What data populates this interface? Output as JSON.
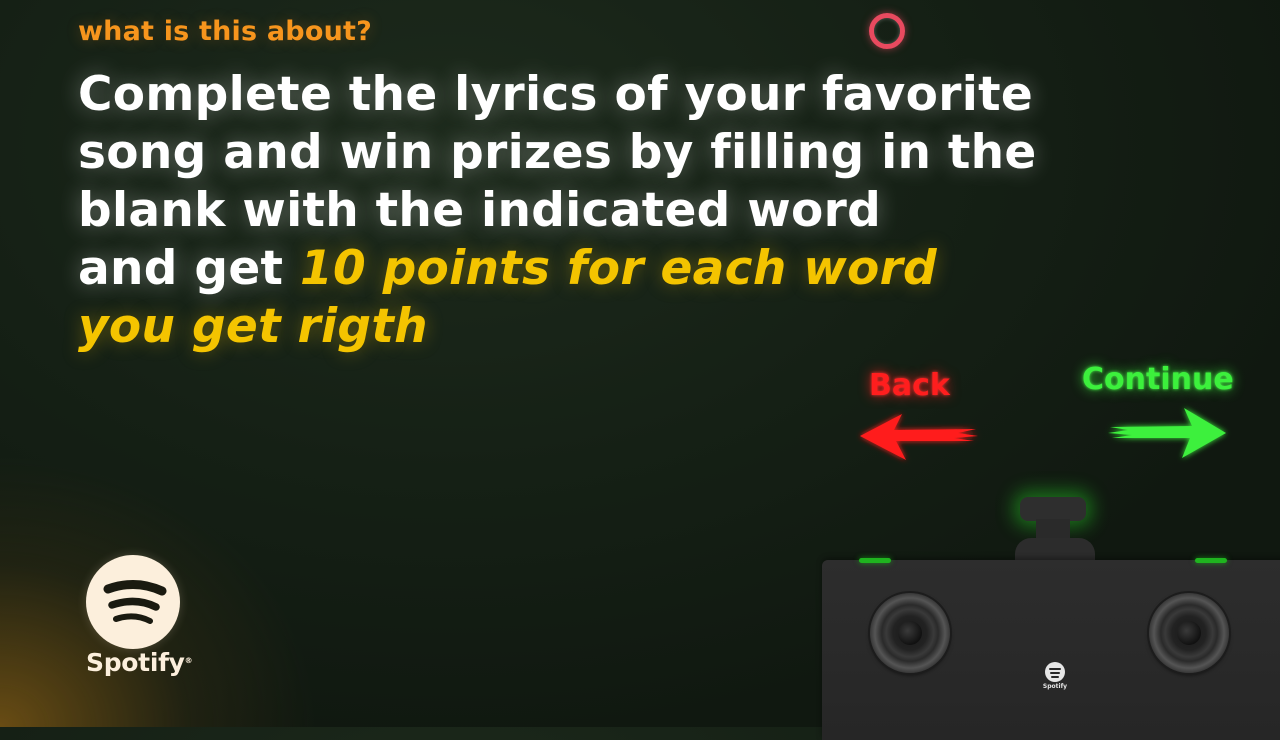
{
  "header": {
    "kicker": "what is this about?"
  },
  "headline": {
    "line1": "Complete the lyrics of  your favorite",
    "line2": "song and win prizes by filling in the",
    "line3": "blank with the indicated word",
    "line4_prefix": "and get ",
    "line4_highlight": "10 points for each word",
    "line5_highlight": "you get rigth"
  },
  "navigation": {
    "back_label": "Back",
    "continue_label": "Continue"
  },
  "brand": {
    "logo_text": "Spotify",
    "trademark": "®",
    "device_logo_text": "Spotify"
  },
  "colors": {
    "kicker": "#f7951d",
    "highlight": "#f4c400",
    "back": "#ff1e1e",
    "continue": "#3cf03c",
    "loader": "#e84a5f",
    "brand_cream": "#fcefdc"
  },
  "icons": {
    "loader": "loading-ring-icon",
    "back": "arrow-left-icon",
    "continue": "arrow-right-icon",
    "logo": "spotify-logo-icon"
  }
}
